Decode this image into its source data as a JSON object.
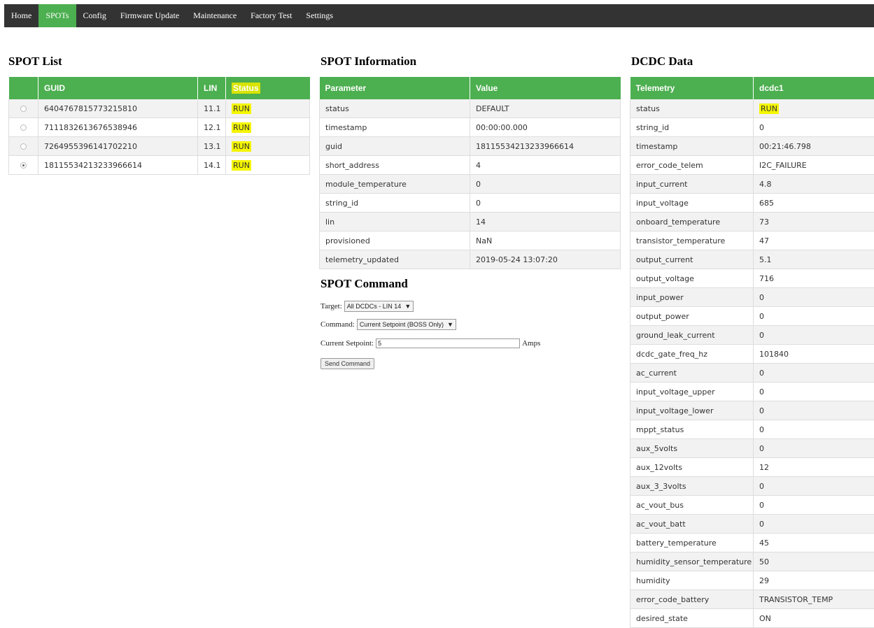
{
  "nav": {
    "items": [
      {
        "label": "Home",
        "active": false
      },
      {
        "label": "SPOTs",
        "active": true
      },
      {
        "label": "Config",
        "active": false
      },
      {
        "label": "Firmware Update",
        "active": false
      },
      {
        "label": "Maintenance",
        "active": false
      },
      {
        "label": "Factory Test",
        "active": false
      },
      {
        "label": "Settings",
        "active": false
      }
    ]
  },
  "spot_list": {
    "title": "SPOT List",
    "headers": [
      "",
      "GUID",
      "LIN",
      "Status"
    ],
    "rows": [
      {
        "guid": "6404767815773215810",
        "lin": "11.1",
        "status": "RUN",
        "selected": false
      },
      {
        "guid": "7111832613676538946",
        "lin": "12.1",
        "status": "RUN",
        "selected": false
      },
      {
        "guid": "7264955396141702210",
        "lin": "13.1",
        "status": "RUN",
        "selected": false
      },
      {
        "guid": "18115534213233966614",
        "lin": "14.1",
        "status": "RUN",
        "selected": true
      }
    ]
  },
  "spot_info": {
    "title": "SPOT Information",
    "headers": [
      "Parameter",
      "Value"
    ],
    "rows": [
      {
        "param": "status",
        "value": "DEFAULT"
      },
      {
        "param": "timestamp",
        "value": "00:00:00.000"
      },
      {
        "param": "guid",
        "value": "18115534213233966614"
      },
      {
        "param": "short_address",
        "value": "4"
      },
      {
        "param": "module_temperature",
        "value": "0"
      },
      {
        "param": "string_id",
        "value": "0"
      },
      {
        "param": "lin",
        "value": "14"
      },
      {
        "param": "provisioned",
        "value": "NaN"
      },
      {
        "param": "telemetry_updated",
        "value": "2019-05-24 13:07:20"
      }
    ]
  },
  "spot_command": {
    "title": "SPOT Command",
    "target_label": "Target:",
    "target_value": "All DCDCs - LIN 14",
    "command_label": "Command:",
    "command_value": "Current Setpoint (BOSS Only)",
    "setpoint_label": "Current Setpoint:",
    "setpoint_value": "5",
    "setpoint_unit": "Amps",
    "send_label": "Send Command",
    "dropdown_arrow": "▼"
  },
  "dcdc": {
    "title": "DCDC Data",
    "headers": [
      "Telemetry",
      "dcdc1"
    ],
    "rows": [
      {
        "param": "status",
        "value": "RUN",
        "highlight": true
      },
      {
        "param": "string_id",
        "value": "0"
      },
      {
        "param": "timestamp",
        "value": "00:21:46.798"
      },
      {
        "param": "error_code_telem",
        "value": "I2C_FAILURE"
      },
      {
        "param": "input_current",
        "value": "4.8"
      },
      {
        "param": "input_voltage",
        "value": "685"
      },
      {
        "param": "onboard_temperature",
        "value": "73"
      },
      {
        "param": "transistor_temperature",
        "value": "47"
      },
      {
        "param": "output_current",
        "value": "5.1"
      },
      {
        "param": "output_voltage",
        "value": "716"
      },
      {
        "param": "input_power",
        "value": "0"
      },
      {
        "param": "output_power",
        "value": "0"
      },
      {
        "param": "ground_leak_current",
        "value": "0"
      },
      {
        "param": "dcdc_gate_freq_hz",
        "value": "101840"
      },
      {
        "param": "ac_current",
        "value": "0"
      },
      {
        "param": "input_voltage_upper",
        "value": "0"
      },
      {
        "param": "input_voltage_lower",
        "value": "0"
      },
      {
        "param": "mppt_status",
        "value": "0"
      },
      {
        "param": "aux_5volts",
        "value": "0"
      },
      {
        "param": "aux_12volts",
        "value": "12"
      },
      {
        "param": "aux_3_3volts",
        "value": "0"
      },
      {
        "param": "ac_vout_bus",
        "value": "0"
      },
      {
        "param": "ac_vout_batt",
        "value": "0"
      },
      {
        "param": "battery_temperature",
        "value": "45"
      },
      {
        "param": "humidity_sensor_temperature",
        "value": "50"
      },
      {
        "param": "humidity",
        "value": "29"
      },
      {
        "param": "error_code_battery",
        "value": "TRANSISTOR_TEMP"
      },
      {
        "param": "desired_state",
        "value": "ON"
      }
    ]
  },
  "colors": {
    "header_green": "#4caf50",
    "nav_dark": "#333333",
    "highlight_yellow": "#f5f500"
  }
}
